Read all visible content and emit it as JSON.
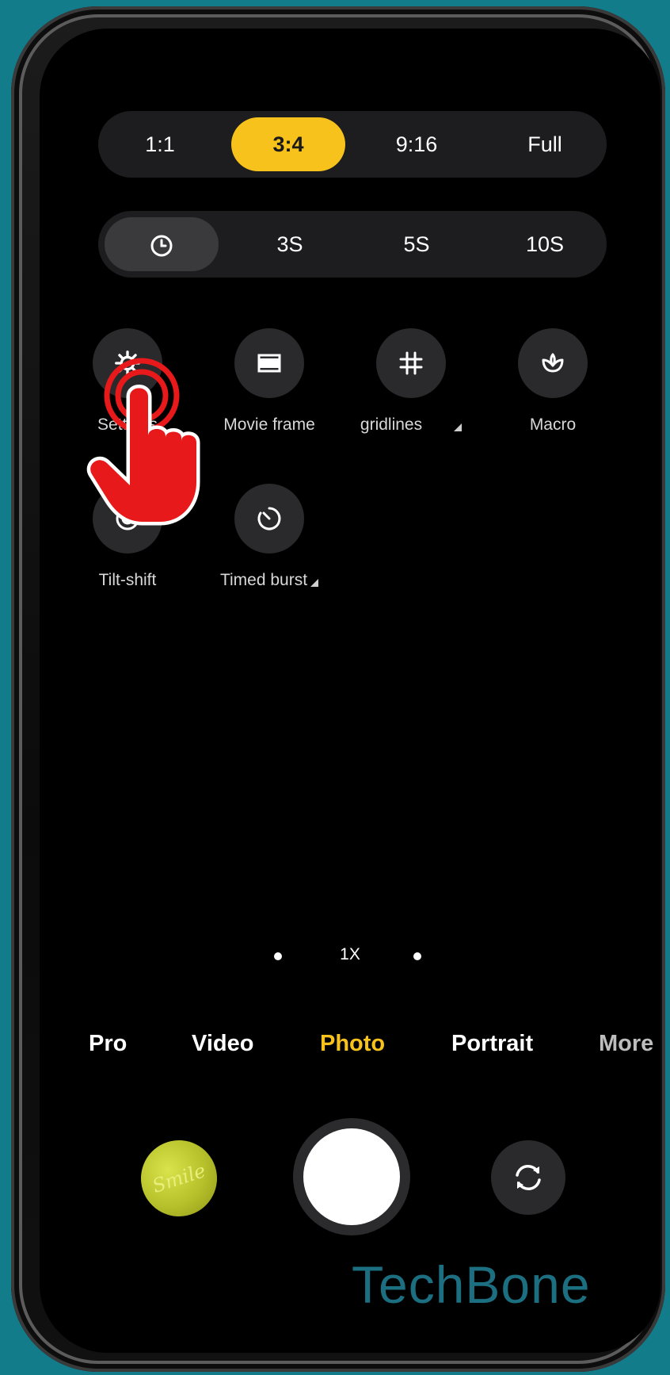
{
  "aspect_ratio": {
    "options": [
      "1:1",
      "3:4",
      "9:16",
      "Full"
    ],
    "selected": "3:4"
  },
  "timer": {
    "options": [
      "3S",
      "5S",
      "10S"
    ],
    "selected": "off"
  },
  "tools": [
    {
      "label": "Settings"
    },
    {
      "label": "Movie frame"
    },
    {
      "label": "gridlines"
    },
    {
      "label": "Macro"
    },
    {
      "label": "Tilt-shift"
    },
    {
      "label": "Timed burst"
    }
  ],
  "zoom": {
    "label": "1X"
  },
  "modes": [
    "Pro",
    "Video",
    "Photo",
    "Portrait",
    "More"
  ],
  "active_mode": "Photo",
  "watermark": "TechBone",
  "colors": {
    "accent": "#f7c21b",
    "background": "#137c8b",
    "pill": "#1d1d1f",
    "tap_indicator": "#e8191a"
  }
}
